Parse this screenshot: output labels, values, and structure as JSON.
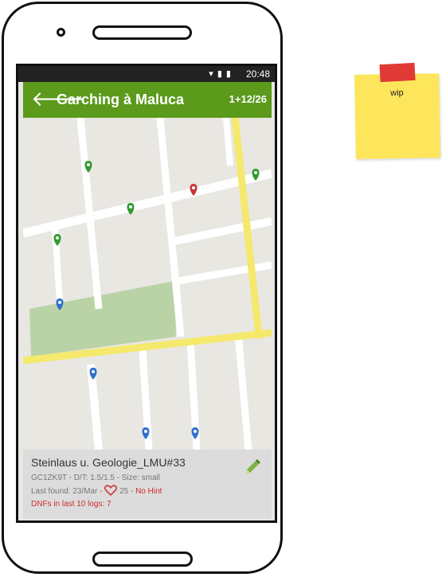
{
  "status_bar": {
    "icons": "▾ ▮ ▮",
    "time": "20:48"
  },
  "app_bar": {
    "title": "Garching à Maluca",
    "counter": "1+12/26"
  },
  "cache": {
    "name": "Steinlaus u. Geologie_LMU#33",
    "code": "GC1ZK9T",
    "dt": "D/T: 1.5/1.5",
    "size": "Size: small",
    "last_found": "Last found: 23/Mar",
    "favorites": "25",
    "hint": "No Hint",
    "dnf": "DNFs in last 10 logs: 7"
  },
  "sticky_note": {
    "text": "wip"
  },
  "colors": {
    "appbar": "#5b9a1b",
    "pin_green": "#2f9b2f",
    "pin_red": "#c93535",
    "pin_blue": "#2f6fd0",
    "road_yellow": "#f4e96c"
  }
}
